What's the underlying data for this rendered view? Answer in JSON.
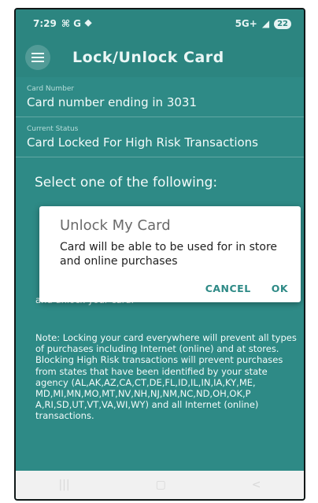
{
  "status_bar": {
    "time": "7:29",
    "left_icons": "⌘ G ⯁",
    "network": "5G+",
    "battery": "22"
  },
  "app_bar": {
    "title": "Lock/Unlock Card",
    "menu_icon": "menu-icon"
  },
  "fields": [
    {
      "label": "Card Number",
      "value": "Card number ending in 3031"
    },
    {
      "label": "Current Status",
      "value": "Card Locked For High Risk Transactions"
    }
  ],
  "select_heading": "Select one of the following:",
  "behind_dialog": {
    "partial_line": "and unlock your card."
  },
  "note": "Note: Locking your card everywhere will prevent all types of purchases including Internet (online) and at stores. Blocking High Risk transactions will prevent purchases from states that have been identified by your state agency (AL,AK,AZ,CA,CT,DE,FL,ID,IL,IN,IA,KY,ME, MD,MI,MN,MO,MT,NV,NH,NJ,NM,NC,ND,OH,OK,P A,RI,SD,UT,VT,VA,WI,WY) and all Internet (online) transactions.",
  "dialog": {
    "title": "Unlock My Card",
    "body": "Card will be able to be used for in store and online purchases",
    "cancel_label": "CANCEL",
    "ok_label": "OK"
  },
  "nav_bar": {
    "recent": "|||",
    "home": "▢",
    "back": "<"
  }
}
